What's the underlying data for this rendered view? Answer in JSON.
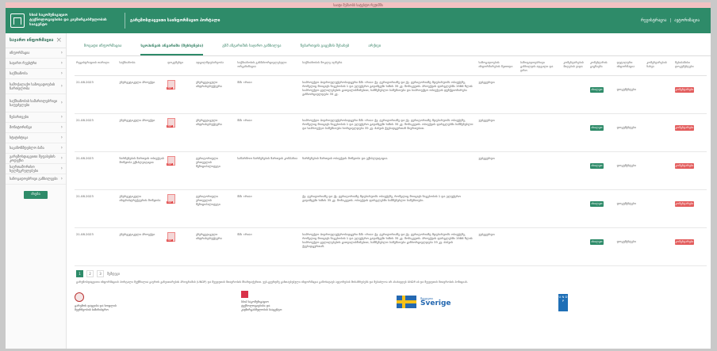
{
  "top_banner": "საიტი მუშაობს სატესტო რეჟიმში",
  "header": {
    "org_line1": "სსიპ საკომუნიკაციო",
    "org_line2": "ტექნოლოგიებისა და კავშირგაბმულობის სააგენტო",
    "title": "გარემოსდაცვითი საინფორმაციო პორტალი",
    "link_register": "რეგისტრაცია",
    "link_login": "ავტორიზაცია"
  },
  "sidebar": {
    "title": "საჯარო ინფორმაცია",
    "items": [
      {
        "label": "ინფორმაცია"
      },
      {
        "label": "საჯარო რეესტრი"
      },
      {
        "label": "საქმიანობა"
      },
      {
        "label": "სამოქალაქო საზოგადოების ჩართულობა"
      },
      {
        "label": "საქმიანობის სამართლებრივი საფუძვლები"
      },
      {
        "label": "ნებართვები"
      },
      {
        "label": "მონიტორინგი"
      },
      {
        "label": "სტატისტიკა"
      },
      {
        "label": "საკანონმდებლო ბაზა"
      },
      {
        "label": "გარემოსდაცვითი შეფასების კოდექსი"
      },
      {
        "label": "საერთაშორისო ხელშეკრულებები"
      },
      {
        "label": "საზოგადოებრივი განხილვები"
      }
    ],
    "button_label": "ძიება"
  },
  "tabs": [
    {
      "label": "ზოგადი ინფორმაცია",
      "active": false
    },
    {
      "label": "სკოპინგის ანგარიში (შეხსენება)",
      "active": true
    },
    {
      "label": "გზშ ანგარიშის საჯარო განხილვა",
      "active": false
    },
    {
      "label": "ნებართვის გაცემის შესახებ",
      "active": false
    },
    {
      "label": "არქივი",
      "active": false
    }
  ],
  "table": {
    "columns": [
      "რეგისტრაციის თარიღი",
      "საქმიანობა",
      "დოკუმენტი",
      "ადგილმდებარეობა",
      "საქმიანობის განმახორციელებელი ორგანიზაცია",
      "საქმიანობის მოკლე აღწერა",
      "საზოგადოების ინფორმირების მეთოდი",
      "საზოგადოებრივი განხილვის ადგილი და დრო",
      "კომენტარების მიღების ვადა",
      "კომენტარის გაგზავნა",
      "დეტალური ინფორმაცია",
      "კომენტარების ნახვა",
      "შესაბამისი დოკუმენტები"
    ],
    "rows": [
      {
        "date": "21.08.2023",
        "activity": "ენერგეტიკული პროექტი",
        "doc": "PDF",
        "location": "ენერგეტიკული ინფრასტრუქტურა",
        "org": "შპს «რია»",
        "desc": "საპროექტო ჰიდროელექტროსადგური შპს «რია» ქვ. ტერიტორიაზე და ქვ. ტერიტორიაზე მდებარეობს ობიექტზე, რომელიც მოიცავს ნაგებობის 1 და ელექტრო გადამცემი ხაზის 35 კვ. მონაკვეთს. პროექტის ფარგლებში 1986 წლის საპროექტო ცვლილებების გათვალისწინებით, სამშენებლო სამუშაოები და საპროექტო ობიექტის ფუნქციონირება განხორციელდება 35 კვ.",
        "method": "ვებგვერდი",
        "place": "",
        "deadline": "",
        "comment_btn": "იხილეთ",
        "detail": "დოკუმენტები",
        "docs_btn": "კომენტარები"
      },
      {
        "date": "21.08.2023",
        "activity": "ენერგეტიკული პროექტი",
        "doc": "PDF",
        "location": "ენერგეტიკული ინფრასტრუქტურა",
        "org": "შპს «რია»",
        "desc": "საპროექტო ჰიდროელექტროსადგური შპს «რია» ქვ. ტერიტორიაზე და ქვ. ტერიტორიაზე მდებარეობს ობიექტზე, რომელიც მოიცავს ნაგებობის 1 და ელექტრო გადამცემი ხაზის 35 კვ. მონაკვეთს. ობიექტის ფარგლებში სამშენებლო და საპროექტო სამუშაოები ხორციელდება 35 კვ. ძაბვის ქვესადგურთან მიერთებით.",
        "method": "ვებგვერდი",
        "place": "",
        "deadline": "",
        "comment_btn": "იხილეთ",
        "detail": "დოკუმენტები",
        "docs_btn": "კომენტარები"
      },
      {
        "date": "21.08.2023",
        "activity": "ნარჩენების მართვის ობიექტის მოწყობა ექსპლუატაცია",
        "doc": "PDF",
        "location": "ტერიტორიული ერთეულის მუნიციპალიტეტი",
        "org": "საწარმოო ნარჩენების მართვის კომპანია",
        "desc": "ნარჩენების მართვის ობიექტის მოწყობა და ექსპლუატაცია.",
        "method": "ვებგვერდი",
        "place": "",
        "deadline": "",
        "comment_btn": "იხილეთ",
        "detail": "დოკუმენტები",
        "docs_btn": "კომენტარები"
      },
      {
        "date": "21.08.2023",
        "activity": "ენერგეტიკული ინფრასტრუქტურის მოწყობა",
        "doc": "PDF",
        "location": "ტერიტორიული ერთეულის მუნიციპალიტეტი",
        "org": "შპს «რია»",
        "desc": "ქვ. ტერიტორიაზე და ქვ. ტერიტორიაზე მდებარეობს ობიექტზე, რომელიც მოიცავს ნაგებობის 1 და ელექტრო გადამცემი ხაზის 35 კვ. მონაკვეთს. ობიექტის ფარგლებში სამშენებლო სამუშაოები.",
        "method": "",
        "place": "",
        "deadline": "",
        "comment_btn": "იხილეთ",
        "detail": "დოკუმენტები",
        "docs_btn": "კომენტარები"
      },
      {
        "date": "21.08.2023",
        "activity": "ენერგეტიკული პროექტი",
        "doc": "PDF",
        "location": "ენერგეტიკული ინფრასტრუქტურა",
        "org": "შპს «რია»",
        "desc": "საპროექტო ჰიდროელექტროსადგური შპს «რია» ქვ. ტერიტორიაზე და ქვ. ტერიტორიაზე მდებარეობს ობიექტზე, რომელიც მოიცავს ნაგებობის 1 და ელექტრო გადამცემი ხაზის 35 კვ. მონაკვეთს. პროექტის ფარგლებში 1986 წლის საპროექტო ცვლილებების გათვალისწინებით, სამშენებლო სამუშაოები განხორციელდება 35 კვ. ძაბვის ქვესადგურთან.",
        "method": "ვებგვერდი",
        "place": "",
        "deadline": "",
        "comment_btn": "იხილეთ",
        "detail": "დოკუმენტები",
        "docs_btn": "კომენტარები"
      }
    ]
  },
  "pagination": {
    "pages": [
      "1",
      "2",
      "3"
    ],
    "next": "შემდეგი"
  },
  "disclaimer": "გარემოსდაცვითი ინფორმაციის პორტალი შექმნილია გაეროს განვითარების პროგრამის (UNDP) და შვედეთის მთავრობის მხარდაჭერით. ვებ-გვერდზე განთავსებული ინფორმაცია გამოხატავს ავტორების მოსაზრებებს და შესაძლოა არ ასახავდეს UNDP-ის და შვედეთის მთავრობის პოზიციას.",
  "partners": {
    "ministry_line1": "გარემოს დაცვისა და სოფლის",
    "ministry_line2": "მეურნეობის სამინისტრო",
    "agency_line1": "სსიპ საკომუნიკაციო",
    "agency_line2": "ტექნოლოგიებისა და",
    "agency_line3": "კავშირგაბმულობის სააგენტო",
    "sverige_small": "შვედეთი",
    "sverige": "Sverige",
    "undp": "U N D P"
  },
  "colors": {
    "brand": "#2e8b69",
    "danger": "#e35d5d",
    "swedish_blue": "#2568b0",
    "undp_blue": "#1f6fb6"
  }
}
